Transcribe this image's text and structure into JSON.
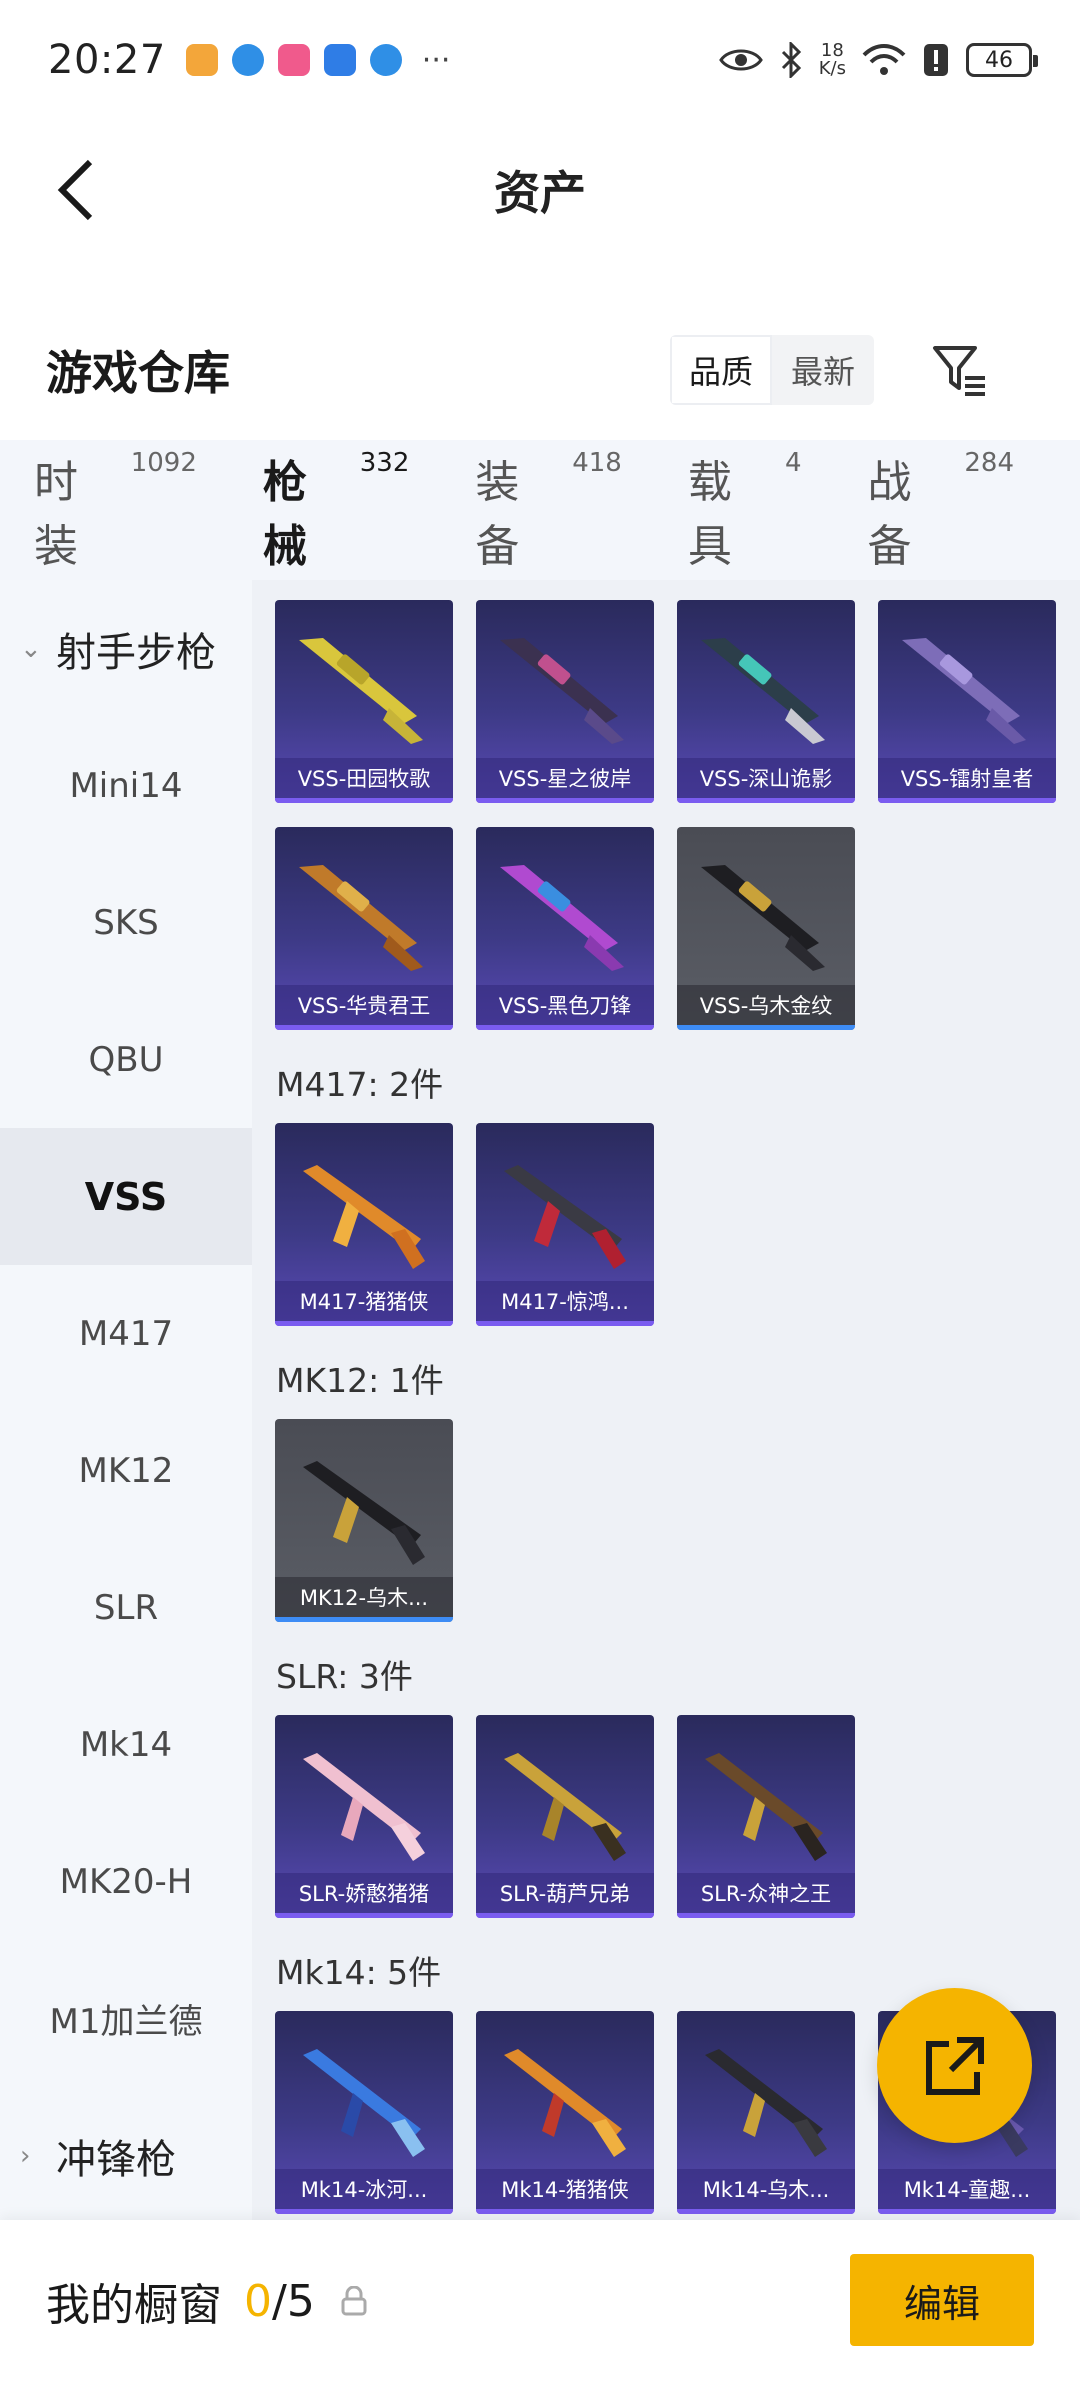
{
  "status_bar": {
    "time": "20:27",
    "speed_value": "18",
    "speed_unit": "K/s",
    "battery": "46"
  },
  "nav": {
    "title": "资产"
  },
  "warehouse": {
    "title": "游戏仓库",
    "sort_options": [
      "品质",
      "最新"
    ],
    "active_sort": "品质"
  },
  "tabs": [
    {
      "label": "时装",
      "count": "1092"
    },
    {
      "label": "枪械",
      "count": "332",
      "active": true
    },
    {
      "label": "装备",
      "count": "418"
    },
    {
      "label": "载具",
      "count": "4"
    },
    {
      "label": "战备",
      "count": "284"
    }
  ],
  "sidebar": {
    "category_top": "射手步枪",
    "items": [
      "Mini14",
      "SKS",
      "QBU",
      "VSS",
      "M417",
      "MK12",
      "SLR",
      "Mk14",
      "MK20-H",
      "M1加兰德"
    ],
    "active": "VSS",
    "category_bottom": "冲锋枪"
  },
  "sections": [
    {
      "label": "",
      "items": [
        "VSS-田园牧歌",
        "VSS-星之彼岸",
        "VSS-深山诡影",
        "VSS-镭射皇者",
        "VSS-华贵君王",
        "VSS-黑色刀锋",
        "VSS-乌木金纹"
      ]
    },
    {
      "label": "M417: 2件",
      "items": [
        "M417-猪猪侠",
        "M417-惊鸿..."
      ]
    },
    {
      "label": "MK12: 1件",
      "items": [
        "MK12-乌木..."
      ]
    },
    {
      "label": "SLR: 3件",
      "items": [
        "SLR-娇憨猪猪",
        "SLR-葫芦兄弟",
        "SLR-众神之王"
      ]
    },
    {
      "label": "Mk14: 5件",
      "items": [
        "Mk14-冰河...",
        "Mk14-猪猪侠",
        "Mk14-乌木...",
        "Mk14-童趣..."
      ]
    }
  ],
  "colors": {
    "accent": "#f5b400",
    "card_purple": "#3d3a86",
    "card_grey": "#55585f"
  },
  "bottom_bar": {
    "title": "我的橱窗",
    "used": "0",
    "total": "/5",
    "edit_label": "编辑"
  }
}
